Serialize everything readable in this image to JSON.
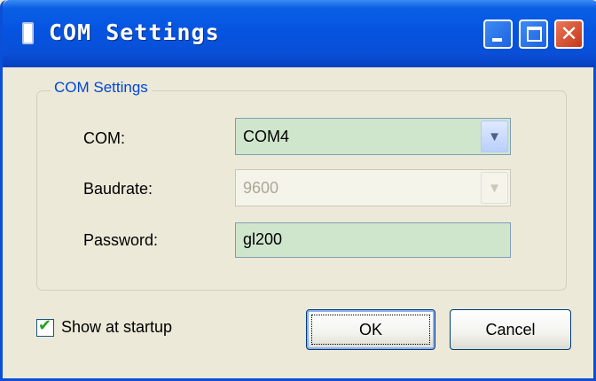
{
  "window": {
    "title": "COM Settings",
    "title_bar_color": "#0a4fd6",
    "controls": {
      "minimize_icon": "minimize-icon",
      "maximize_icon": "maximize-icon",
      "close_icon": "close-icon",
      "close_glyph": "✕"
    }
  },
  "group": {
    "legend": "COM Settings",
    "com": {
      "label": "COM:",
      "value": "COM4",
      "enabled": true
    },
    "baudrate": {
      "label": "Baudrate:",
      "value": "9600",
      "enabled": false
    },
    "password": {
      "label": "Password:",
      "value": "gl200"
    }
  },
  "startup": {
    "label": "Show at startup",
    "checked": true
  },
  "buttons": {
    "ok": "OK",
    "cancel": "Cancel"
  },
  "colors": {
    "field_bg": "#cfe6cd",
    "legend": "#0046d5",
    "dialog_bg": "#ece9d8"
  }
}
